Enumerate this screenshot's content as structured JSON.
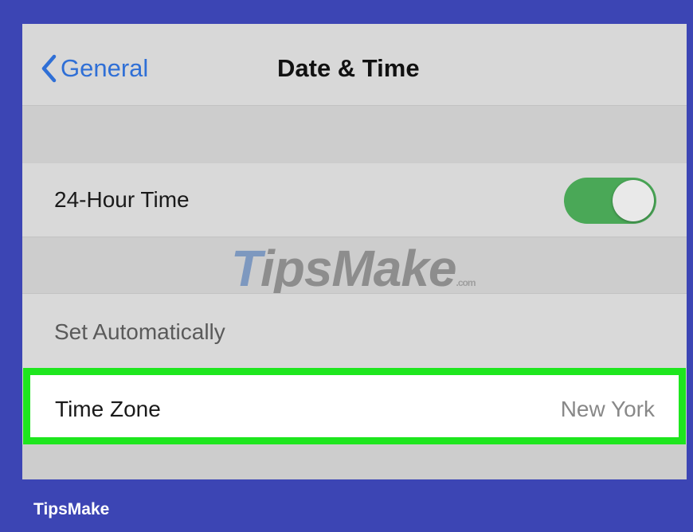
{
  "navbar": {
    "back_label": "General",
    "title": "Date & Time"
  },
  "settings": {
    "hour24": {
      "label": "24-Hour Time",
      "enabled": true
    },
    "set_automatically": {
      "label": "Set Automatically"
    },
    "time_zone": {
      "label": "Time Zone",
      "value": "New York"
    }
  },
  "watermark": {
    "t": "T",
    "rest": "ipsMake",
    "suffix": ".com"
  },
  "footer": {
    "brand": "TipsMake"
  },
  "colors": {
    "background": "#3c45b4",
    "accent_blue": "#2f6fd6",
    "toggle_on": "#4aa857",
    "highlight": "#1ee61e"
  }
}
